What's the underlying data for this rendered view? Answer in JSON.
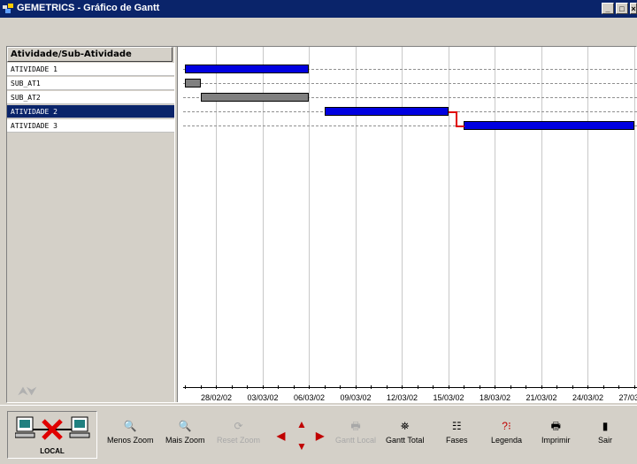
{
  "window": {
    "title": "GEMETRICS - Gráfico de Gantt",
    "buttons": [
      "_",
      "□",
      "×"
    ]
  },
  "list": {
    "header": "Atividade/Sub-Atividade",
    "rows": [
      {
        "label": "ATIVIDADE 1",
        "selected": false
      },
      {
        "label": "SUB_AT1",
        "selected": false
      },
      {
        "label": "SUB_AT2",
        "selected": false
      },
      {
        "label": "ATIVIDADE 2",
        "selected": true
      },
      {
        "label": "ATIVIDADE 3",
        "selected": false
      }
    ],
    "scroll_arrows": "⮝⮟"
  },
  "chart_data": {
    "type": "gantt",
    "x_ticks": [
      "28/02/02",
      "03/03/02",
      "06/03/02",
      "09/03/02",
      "12/03/02",
      "15/03/02",
      "18/03/02",
      "21/03/02",
      "24/03/02",
      "27/03"
    ],
    "tasks": [
      {
        "name": "ATIVIDADE 1",
        "start": "26/02/02",
        "end": "06/03/02",
        "color": "#0000e0"
      },
      {
        "name": "SUB_AT1",
        "start": "26/02/02",
        "end": "27/02/02",
        "color": "#808080"
      },
      {
        "name": "SUB_AT2",
        "start": "27/02/02",
        "end": "06/03/02",
        "color": "#808080"
      },
      {
        "name": "ATIVIDADE 2",
        "start": "07/03/02",
        "end": "15/03/02",
        "color": "#0000e0"
      },
      {
        "name": "ATIVIDADE 3",
        "start": "16/03/02",
        "end": "27/03/02",
        "color": "#0000e0"
      }
    ],
    "dependency": {
      "from": "ATIVIDADE 2",
      "to": "ATIVIDADE 3",
      "color": "#e00000"
    }
  },
  "toolbar": {
    "local_label": "LOCAL",
    "buttons": [
      {
        "label": "Menos Zoom",
        "icon": "zoom-out-icon",
        "glyph": "🔍",
        "enabled": true
      },
      {
        "label": "Mais Zoom",
        "icon": "zoom-in-icon",
        "glyph": "🔍",
        "enabled": true
      },
      {
        "label": "Reset Zoom",
        "icon": "reset-zoom-icon",
        "glyph": "⟳",
        "enabled": false
      },
      {
        "label": "Gantt Local",
        "icon": "printer-icon",
        "glyph": "🖶",
        "enabled": false
      },
      {
        "label": "Gantt Total",
        "icon": "gantt-total-icon",
        "glyph": "⛯",
        "enabled": true
      },
      {
        "label": "Fases",
        "icon": "phases-icon",
        "glyph": "☷",
        "enabled": true
      },
      {
        "label": "Legenda",
        "icon": "legend-icon",
        "glyph": "?⁝",
        "enabled": true
      },
      {
        "label": "Imprimir",
        "icon": "print-icon",
        "glyph": "🖶",
        "enabled": true
      },
      {
        "label": "Sair",
        "icon": "exit-icon",
        "glyph": "▮",
        "enabled": true
      }
    ]
  }
}
